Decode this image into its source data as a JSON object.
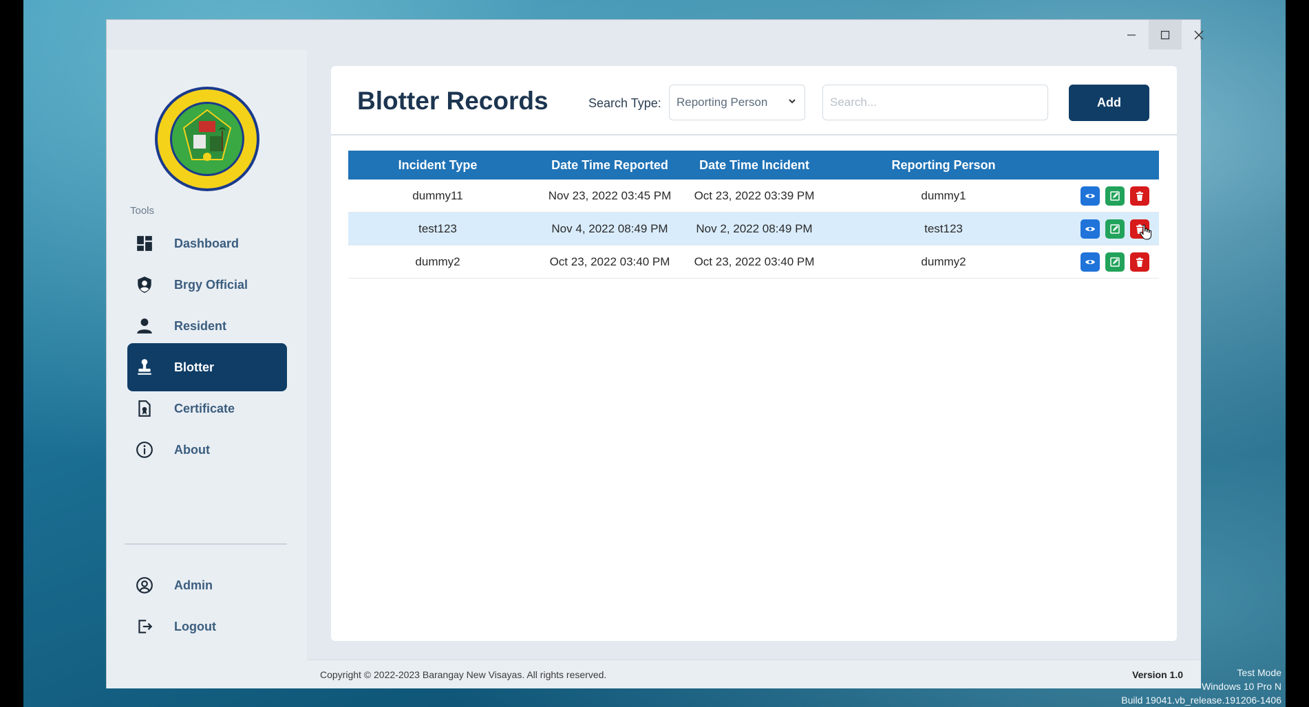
{
  "window": {
    "minimize_icon": "minimize-icon",
    "maximize_icon": "maximize-icon",
    "close_icon": "close-icon"
  },
  "sidebar": {
    "tools_label": "Tools",
    "items": [
      {
        "label": "Dashboard",
        "icon": "dashboard-icon"
      },
      {
        "label": "Brgy Official",
        "icon": "shield-user-icon"
      },
      {
        "label": "Resident",
        "icon": "person-icon"
      },
      {
        "label": "Blotter",
        "icon": "stamp-icon",
        "active": true
      },
      {
        "label": "Certificate",
        "icon": "certificate-icon"
      },
      {
        "label": "About",
        "icon": "info-icon"
      }
    ],
    "bottom_items": [
      {
        "label": "Admin",
        "icon": "user-circle-icon"
      },
      {
        "label": "Logout",
        "icon": "logout-icon"
      }
    ]
  },
  "header": {
    "title": "Blotter Records",
    "search_type_label": "Search Type:",
    "search_type_value": "Reporting Person",
    "search_placeholder": "Search...",
    "add_label": "Add"
  },
  "table": {
    "columns": [
      "Incident Type",
      "Date Time Reported",
      "Date Time Incident",
      "Reporting Person"
    ],
    "rows": [
      {
        "incident_type": "dummy11",
        "reported": "Nov 23, 2022 03:45 PM",
        "incident": "Oct 23, 2022 03:39 PM",
        "person": "dummy1"
      },
      {
        "incident_type": "test123",
        "reported": "Nov 4, 2022 08:49 PM",
        "incident": "Nov 2, 2022 08:49 PM",
        "person": "test123"
      },
      {
        "incident_type": "dummy2",
        "reported": "Oct 23, 2022 03:40 PM",
        "incident": "Oct 23, 2022 03:40 PM",
        "person": "dummy2"
      }
    ]
  },
  "footer": {
    "copyright": "Copyright © 2022-2023 Barangay New Visayas. All rights reserved.",
    "version": "Version 1.0"
  },
  "watermark": {
    "line1": "Test Mode",
    "line2": "Windows 10 Pro N",
    "line3": "Build 19041.vb_release.191206-1406"
  },
  "colors": {
    "primary": "#0f3d66",
    "table_header": "#1f73b7",
    "view": "#1f73d9",
    "edit": "#22a35b",
    "delete": "#d71a1a"
  }
}
